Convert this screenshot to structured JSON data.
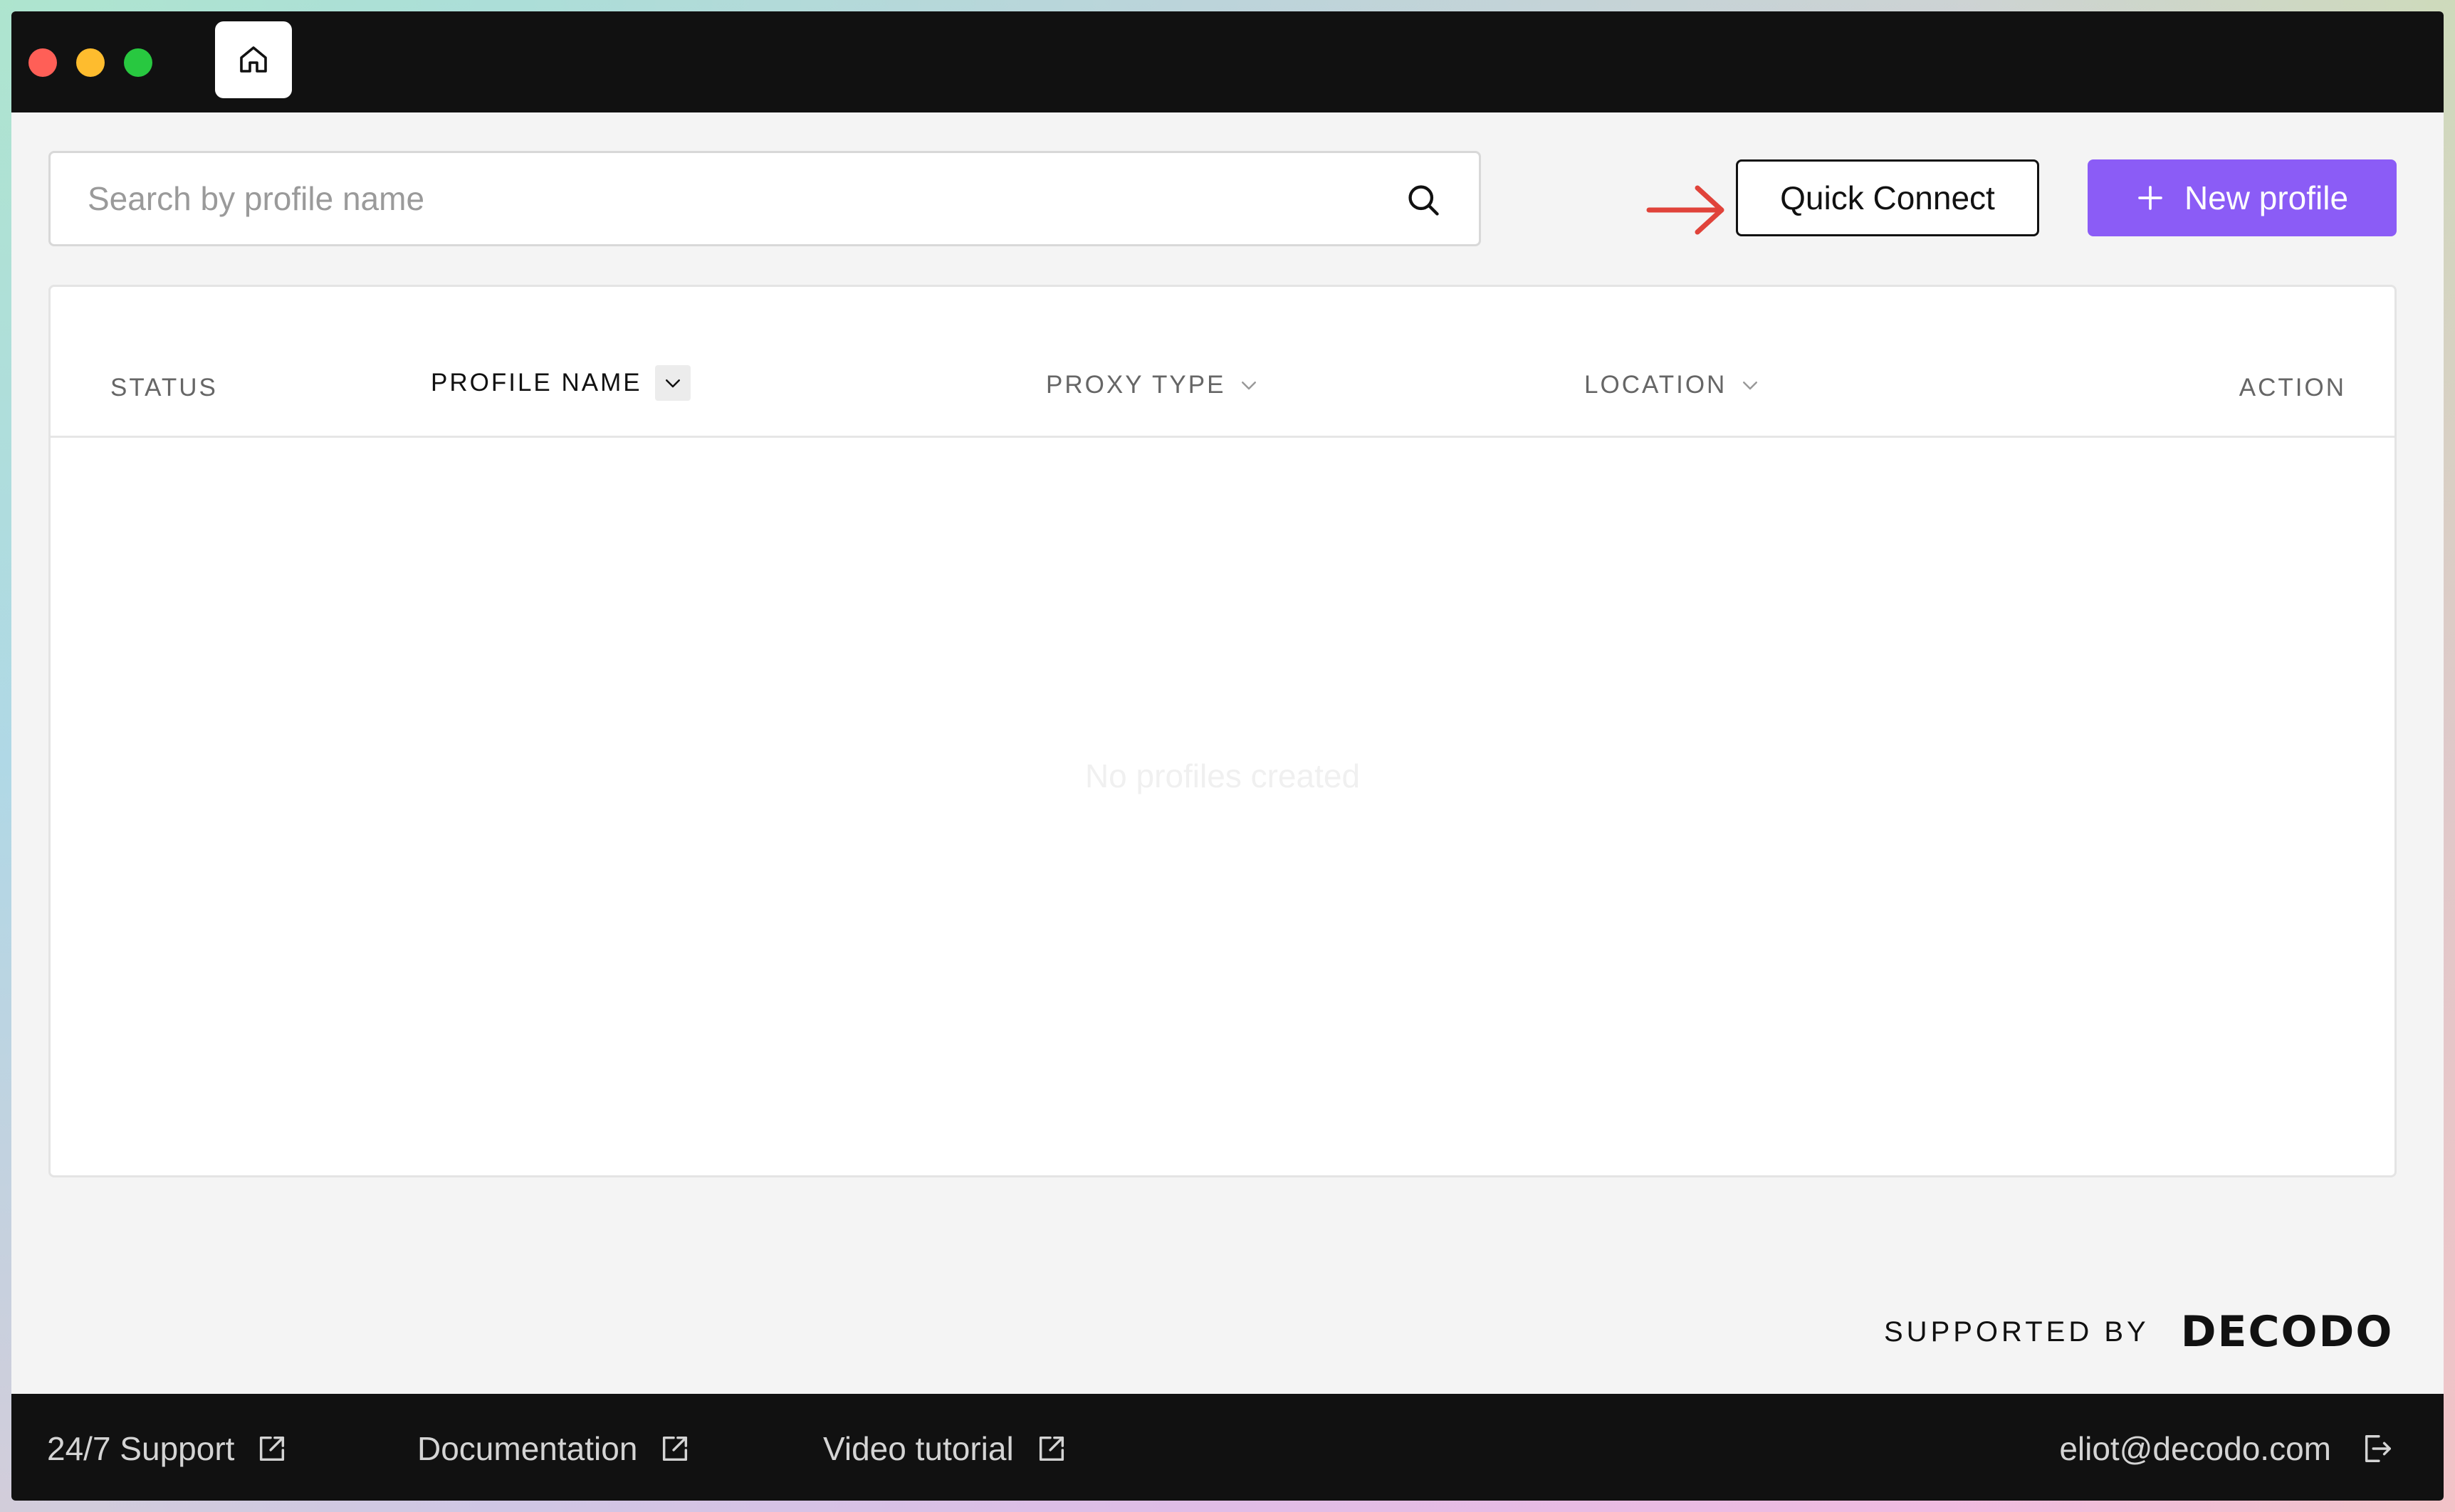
{
  "window": {
    "traffic_lights": {
      "close": "#ff5f57",
      "minimize": "#febc2e",
      "maximize": "#28c840"
    },
    "home_tab_icon": "home-icon"
  },
  "toolbar": {
    "search_placeholder": "Search by profile name",
    "search_value": "",
    "search_icon": "search-icon",
    "quick_connect_label": "Quick Connect",
    "new_profile_label": "New profile",
    "new_profile_icon": "plus-icon",
    "accent_color": "#8b5cf6",
    "annotation_arrow_color": "#e0433a"
  },
  "table": {
    "columns": [
      {
        "label": "STATUS",
        "sortable": false
      },
      {
        "label": "PROFILE NAME",
        "sortable": true,
        "active": true
      },
      {
        "label": "PROXY TYPE",
        "sortable": true
      },
      {
        "label": "LOCATION",
        "sortable": true
      },
      {
        "label": "ACTION",
        "sortable": false
      }
    ],
    "rows": [],
    "empty_message": "No profiles created"
  },
  "branding": {
    "supported_by_label": "SUPPORTED BY",
    "logo_text": "DECODO"
  },
  "footer": {
    "links": [
      {
        "label": "24/7 Support",
        "icon": "external-link-icon"
      },
      {
        "label": "Documentation",
        "icon": "external-link-icon"
      },
      {
        "label": "Video tutorial",
        "icon": "external-link-icon"
      }
    ],
    "user_email": "eliot@decodo.com",
    "logout_icon": "logout-icon"
  }
}
